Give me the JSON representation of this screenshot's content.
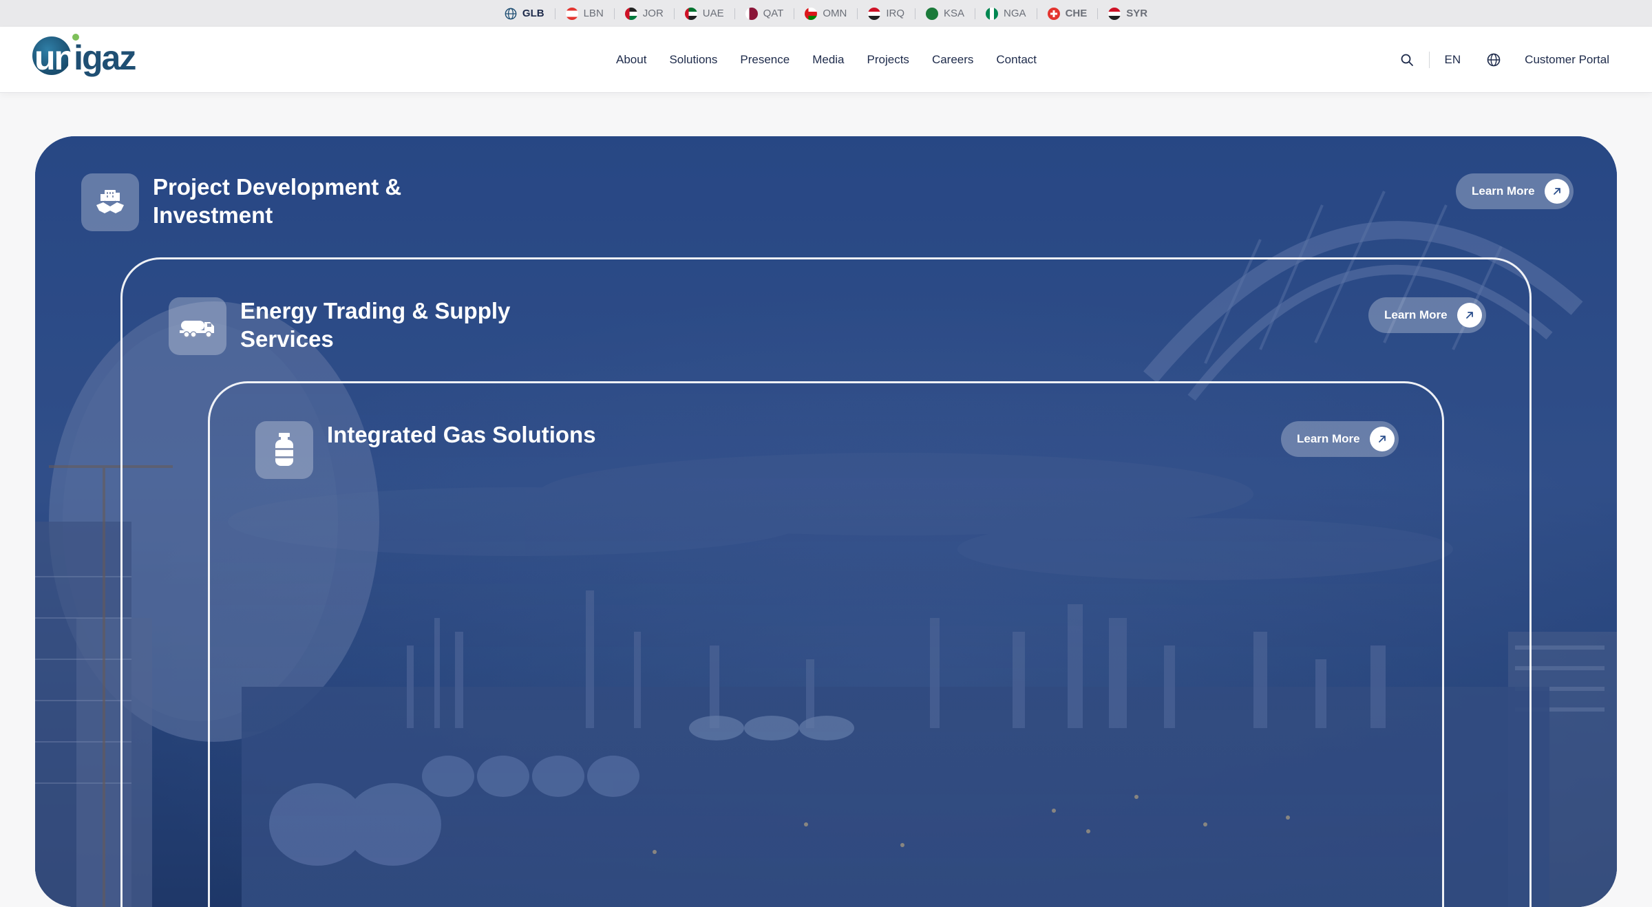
{
  "countries": [
    {
      "code": "GLB",
      "state": "active"
    },
    {
      "code": "LBN",
      "state": "normal"
    },
    {
      "code": "JOR",
      "state": "normal"
    },
    {
      "code": "UAE",
      "state": "normal"
    },
    {
      "code": "QAT",
      "state": "normal"
    },
    {
      "code": "OMN",
      "state": "normal"
    },
    {
      "code": "IRQ",
      "state": "normal"
    },
    {
      "code": "KSA",
      "state": "normal"
    },
    {
      "code": "NGA",
      "state": "normal"
    },
    {
      "code": "CHE",
      "state": "bold"
    },
    {
      "code": "SYR",
      "state": "bold"
    }
  ],
  "brand": {
    "logo_un": "un",
    "logo_rest": "igaz"
  },
  "nav": {
    "about": "About",
    "solutions": "Solutions",
    "presence": "Presence",
    "media": "Media",
    "projects": "Projects",
    "careers": "Careers",
    "contact": "Contact"
  },
  "utils": {
    "language": "EN",
    "portal": "Customer Portal"
  },
  "cards": [
    {
      "title": "Project Development & Investment",
      "button": "Learn More",
      "icon": "handshake-building-icon"
    },
    {
      "title": "Energy Trading & Supply Services",
      "button": "Learn More",
      "icon": "tanker-truck-icon"
    },
    {
      "title": "Integrated Gas Solutions",
      "button": "Learn More",
      "icon": "gas-cylinder-icon"
    }
  ],
  "colors": {
    "brand_blue": "#1f4f73",
    "brand_green": "#7ec05a",
    "nav_text": "#1d2a4a",
    "hero_overlay": "#2b4f8c"
  }
}
